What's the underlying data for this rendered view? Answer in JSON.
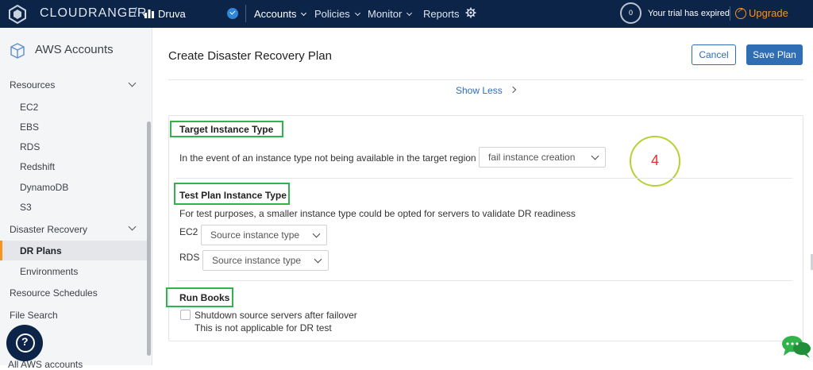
{
  "topbar": {
    "brand": "CLOUDRANGER",
    "slash": "/",
    "org": "Druva",
    "nav": [
      {
        "label": "Accounts"
      },
      {
        "label": "Policies"
      },
      {
        "label": "Monitor"
      },
      {
        "label": "Reports"
      }
    ],
    "trial_count": "0",
    "trial_text": "Your trial has expired",
    "upgrade_label": "Upgrade",
    "colors": {
      "bar": "#0b2447",
      "accent": "#f7941d"
    }
  },
  "sidebar": {
    "title": "AWS Accounts",
    "resources_label": "Resources",
    "resource_items": [
      "EC2",
      "EBS",
      "RDS",
      "Redshift",
      "DynamoDB",
      "S3"
    ],
    "dr_label": "Disaster Recovery",
    "dr_selected": "DR Plans",
    "dr_items": [
      "Environments"
    ],
    "resource_schedules": "Resource Schedules",
    "file_search": "File Search",
    "cut_text": "All AWS accounts"
  },
  "main": {
    "title": "Create Disaster Recovery Plan",
    "cancel_label": "Cancel",
    "save_label": "Save Plan",
    "show_less": "Show Less",
    "target": {
      "title": "Target Instance Type",
      "text": "In the event of an instance type not being available in the target region",
      "select_value": "fail instance creation"
    },
    "step_number": "4",
    "test_plan": {
      "title": "Test Plan Instance Type",
      "text": "For test purposes, a smaller instance type could be opted for servers to validate DR readiness",
      "ec2_label": "EC2",
      "ec2_placeholder": "Source instance type",
      "rds_label": "RDS",
      "rds_placeholder": "Source instance type"
    },
    "run_books": {
      "title": "Run Books",
      "checkbox_label": "Shutdown source servers after failover",
      "note": "This is not applicable for DR test"
    }
  }
}
